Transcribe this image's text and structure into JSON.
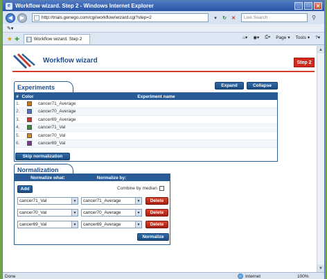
{
  "browser": {
    "window_title": "Workflow wizard. Step 2 - Windows Internet Explorer",
    "url": "http://trials.genego.com/cgi/workflow/wizard.cgi?step=2",
    "search_placeholder": "Live Search",
    "tab_title": "Workflow wizard. Step 2",
    "commands": [
      "Page",
      "Tools"
    ],
    "status_text": "Done",
    "zone_text": "Internet",
    "zoom_text": "100%"
  },
  "wizard": {
    "title": "Workflow wizard",
    "step_badge": "Step 2"
  },
  "experiments": {
    "section_title": "Experiments",
    "expand_label": "Expand",
    "collapse_label": "Collapse",
    "columns": [
      "#",
      "Color",
      "Experiment name"
    ],
    "rows": [
      {
        "num": "1.",
        "color": "#c77a1e",
        "name": "cancer71_Average"
      },
      {
        "num": "2.",
        "color": "#4f77b8",
        "name": "cancer70_Average"
      },
      {
        "num": "3.",
        "color": "#c33a2f",
        "name": "cancer69_Average"
      },
      {
        "num": "4.",
        "color": "#3a8a3a",
        "name": "cancer71_Val"
      },
      {
        "num": "5.",
        "color": "#d08a3a",
        "name": "cancer70_Val"
      },
      {
        "num": "6.",
        "color": "#7a3a8a",
        "name": "cancer69_Val"
      }
    ],
    "skip_label": "Skip normalization"
  },
  "normalization": {
    "section_title": "Normalization",
    "col_what": "Normalize what:",
    "col_by": "Normalize by:",
    "add_label": "Add",
    "combine_label": "Combine by median",
    "rows": [
      {
        "what": "cancer71_Val",
        "by": "cancer71_Average",
        "delete_label": "Delete"
      },
      {
        "what": "cancer70_Val",
        "by": "cancer70_Average",
        "delete_label": "Delete"
      },
      {
        "what": "cancer69_Val",
        "by": "cancer69_Average",
        "delete_label": "Delete"
      }
    ],
    "normalize_label": "Normalize"
  }
}
